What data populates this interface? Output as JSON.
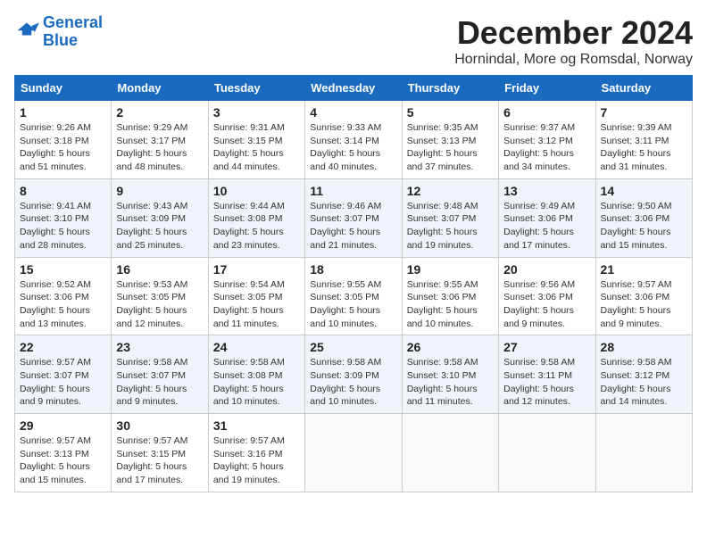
{
  "header": {
    "logo_line1": "General",
    "logo_line2": "Blue",
    "month": "December 2024",
    "location": "Hornindal, More og Romsdal, Norway"
  },
  "weekdays": [
    "Sunday",
    "Monday",
    "Tuesday",
    "Wednesday",
    "Thursday",
    "Friday",
    "Saturday"
  ],
  "weeks": [
    [
      {
        "day": "1",
        "info": "Sunrise: 9:26 AM\nSunset: 3:18 PM\nDaylight: 5 hours\nand 51 minutes."
      },
      {
        "day": "2",
        "info": "Sunrise: 9:29 AM\nSunset: 3:17 PM\nDaylight: 5 hours\nand 48 minutes."
      },
      {
        "day": "3",
        "info": "Sunrise: 9:31 AM\nSunset: 3:15 PM\nDaylight: 5 hours\nand 44 minutes."
      },
      {
        "day": "4",
        "info": "Sunrise: 9:33 AM\nSunset: 3:14 PM\nDaylight: 5 hours\nand 40 minutes."
      },
      {
        "day": "5",
        "info": "Sunrise: 9:35 AM\nSunset: 3:13 PM\nDaylight: 5 hours\nand 37 minutes."
      },
      {
        "day": "6",
        "info": "Sunrise: 9:37 AM\nSunset: 3:12 PM\nDaylight: 5 hours\nand 34 minutes."
      },
      {
        "day": "7",
        "info": "Sunrise: 9:39 AM\nSunset: 3:11 PM\nDaylight: 5 hours\nand 31 minutes."
      }
    ],
    [
      {
        "day": "8",
        "info": "Sunrise: 9:41 AM\nSunset: 3:10 PM\nDaylight: 5 hours\nand 28 minutes."
      },
      {
        "day": "9",
        "info": "Sunrise: 9:43 AM\nSunset: 3:09 PM\nDaylight: 5 hours\nand 25 minutes."
      },
      {
        "day": "10",
        "info": "Sunrise: 9:44 AM\nSunset: 3:08 PM\nDaylight: 5 hours\nand 23 minutes."
      },
      {
        "day": "11",
        "info": "Sunrise: 9:46 AM\nSunset: 3:07 PM\nDaylight: 5 hours\nand 21 minutes."
      },
      {
        "day": "12",
        "info": "Sunrise: 9:48 AM\nSunset: 3:07 PM\nDaylight: 5 hours\nand 19 minutes."
      },
      {
        "day": "13",
        "info": "Sunrise: 9:49 AM\nSunset: 3:06 PM\nDaylight: 5 hours\nand 17 minutes."
      },
      {
        "day": "14",
        "info": "Sunrise: 9:50 AM\nSunset: 3:06 PM\nDaylight: 5 hours\nand 15 minutes."
      }
    ],
    [
      {
        "day": "15",
        "info": "Sunrise: 9:52 AM\nSunset: 3:06 PM\nDaylight: 5 hours\nand 13 minutes."
      },
      {
        "day": "16",
        "info": "Sunrise: 9:53 AM\nSunset: 3:05 PM\nDaylight: 5 hours\nand 12 minutes."
      },
      {
        "day": "17",
        "info": "Sunrise: 9:54 AM\nSunset: 3:05 PM\nDaylight: 5 hours\nand 11 minutes."
      },
      {
        "day": "18",
        "info": "Sunrise: 9:55 AM\nSunset: 3:05 PM\nDaylight: 5 hours\nand 10 minutes."
      },
      {
        "day": "19",
        "info": "Sunrise: 9:55 AM\nSunset: 3:06 PM\nDaylight: 5 hours\nand 10 minutes."
      },
      {
        "day": "20",
        "info": "Sunrise: 9:56 AM\nSunset: 3:06 PM\nDaylight: 5 hours\nand 9 minutes."
      },
      {
        "day": "21",
        "info": "Sunrise: 9:57 AM\nSunset: 3:06 PM\nDaylight: 5 hours\nand 9 minutes."
      }
    ],
    [
      {
        "day": "22",
        "info": "Sunrise: 9:57 AM\nSunset: 3:07 PM\nDaylight: 5 hours\nand 9 minutes."
      },
      {
        "day": "23",
        "info": "Sunrise: 9:58 AM\nSunset: 3:07 PM\nDaylight: 5 hours\nand 9 minutes."
      },
      {
        "day": "24",
        "info": "Sunrise: 9:58 AM\nSunset: 3:08 PM\nDaylight: 5 hours\nand 10 minutes."
      },
      {
        "day": "25",
        "info": "Sunrise: 9:58 AM\nSunset: 3:09 PM\nDaylight: 5 hours\nand 10 minutes."
      },
      {
        "day": "26",
        "info": "Sunrise: 9:58 AM\nSunset: 3:10 PM\nDaylight: 5 hours\nand 11 minutes."
      },
      {
        "day": "27",
        "info": "Sunrise: 9:58 AM\nSunset: 3:11 PM\nDaylight: 5 hours\nand 12 minutes."
      },
      {
        "day": "28",
        "info": "Sunrise: 9:58 AM\nSunset: 3:12 PM\nDaylight: 5 hours\nand 14 minutes."
      }
    ],
    [
      {
        "day": "29",
        "info": "Sunrise: 9:57 AM\nSunset: 3:13 PM\nDaylight: 5 hours\nand 15 minutes."
      },
      {
        "day": "30",
        "info": "Sunrise: 9:57 AM\nSunset: 3:15 PM\nDaylight: 5 hours\nand 17 minutes."
      },
      {
        "day": "31",
        "info": "Sunrise: 9:57 AM\nSunset: 3:16 PM\nDaylight: 5 hours\nand 19 minutes."
      },
      null,
      null,
      null,
      null
    ]
  ]
}
